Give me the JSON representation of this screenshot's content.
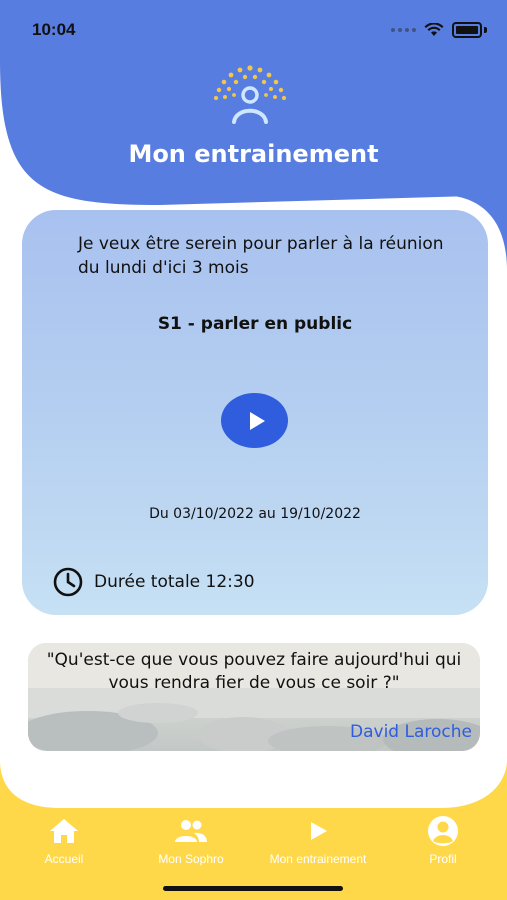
{
  "status_bar": {
    "time": "10:04"
  },
  "header": {
    "title": "Mon entrainement",
    "logo_icon": "sun-person-icon"
  },
  "session": {
    "goal": "Je veux être serein pour parler à la réunion du lundi d'ici 3 mois",
    "title": "S1 - parler en public",
    "date_range": "Du 03/10/2022 au 19/10/2022",
    "duration_label": "Durée totale 12:30"
  },
  "quote": {
    "text": "\"Qu'est-ce que vous pouvez faire aujourd'hui qui vous rendra fier de vous ce soir ?\"",
    "author": "David Laroche"
  },
  "tabs": [
    {
      "label": "Accueil",
      "icon": "home-icon"
    },
    {
      "label": "Mon Sophro",
      "icon": "people-icon"
    },
    {
      "label": "Mon entrainement",
      "icon": "play-icon"
    },
    {
      "label": "Profil",
      "icon": "profile-icon"
    }
  ],
  "colors": {
    "blue": "#587de0",
    "yellow": "#ffd84a",
    "accent": "#2f5dde"
  }
}
